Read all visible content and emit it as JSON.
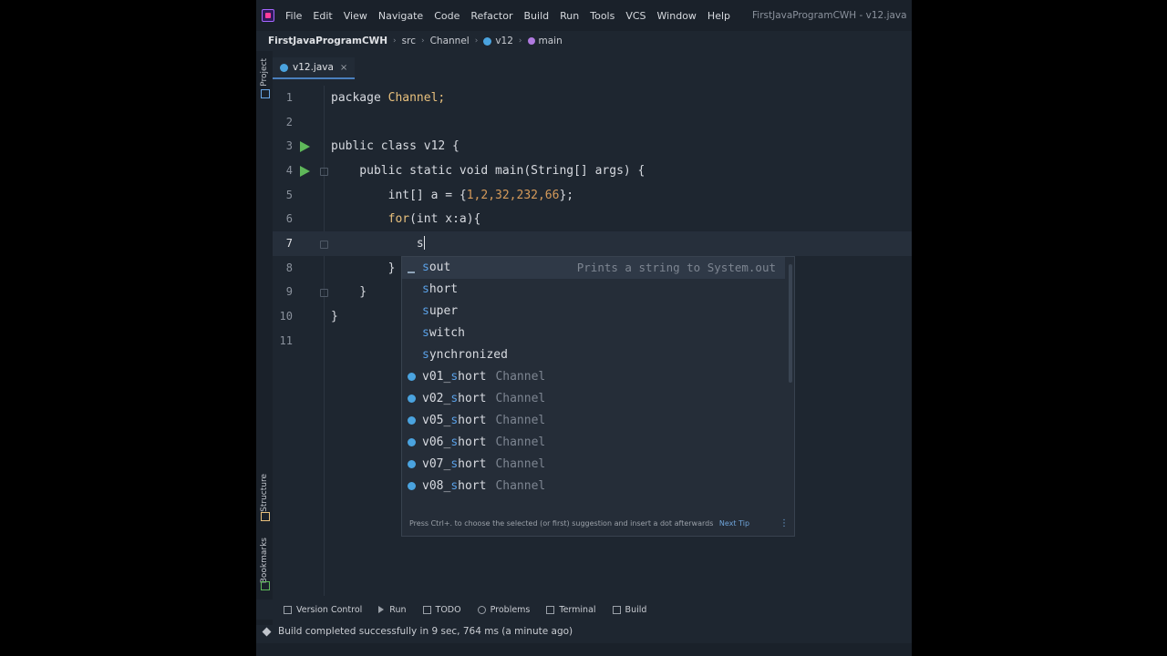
{
  "menubar": {
    "items": [
      "File",
      "Edit",
      "View",
      "Navigate",
      "Code",
      "Refactor",
      "Build",
      "Run",
      "Tools",
      "VCS",
      "Window",
      "Help"
    ],
    "window_title": "FirstJavaProgramCWH - v12.java"
  },
  "breadcrumb": [
    "FirstJavaProgramCWH",
    "src",
    "Channel",
    "v12",
    "main"
  ],
  "leftbar": {
    "project": "Project",
    "structure": "Structure",
    "bookmarks": "Bookmarks"
  },
  "tab": {
    "label": "v12.java",
    "close": "×"
  },
  "editor": {
    "lines": [
      {
        "n": "1"
      },
      {
        "n": "2"
      },
      {
        "n": "3"
      },
      {
        "n": "4"
      },
      {
        "n": "5"
      },
      {
        "n": "6"
      },
      {
        "n": "7"
      },
      {
        "n": "8"
      },
      {
        "n": "9"
      },
      {
        "n": "10"
      },
      {
        "n": "11"
      }
    ],
    "code": {
      "l1a": "package ",
      "l1b": "Channel;",
      "l3": "public class v12 {",
      "l4": "    public static void main(String[] args) {",
      "l5a": "        int[] a = {",
      "l5b": "1,2,32,232,66",
      "l5c": "};",
      "l6a": "        ",
      "l6b": "for",
      "l6c": "(int x:a){",
      "l7": "            s",
      "l8": "        }",
      "l9": "    }",
      "l10": "}"
    }
  },
  "completion": {
    "items": [
      {
        "prefix": "s",
        "rest": "out",
        "desc": "Prints a string to System.out",
        "pkg": ""
      },
      {
        "prefix": "s",
        "rest": "hort",
        "desc": "",
        "pkg": ""
      },
      {
        "prefix": "s",
        "rest": "uper",
        "desc": "",
        "pkg": ""
      },
      {
        "prefix": "s",
        "rest": "witch",
        "desc": "",
        "pkg": ""
      },
      {
        "prefix": "s",
        "rest": "ynchronized",
        "desc": "",
        "pkg": ""
      },
      {
        "before": "v01_",
        "prefix": "s",
        "rest": "hort",
        "pkg": "Channel"
      },
      {
        "before": "v02_",
        "prefix": "s",
        "rest": "hort",
        "pkg": "Channel"
      },
      {
        "before": "v05_",
        "prefix": "s",
        "rest": "hort",
        "pkg": "Channel"
      },
      {
        "before": "v06_",
        "prefix": "s",
        "rest": "hort",
        "pkg": "Channel"
      },
      {
        "before": "v07_",
        "prefix": "s",
        "rest": "hort",
        "pkg": "Channel"
      },
      {
        "before": "v08_",
        "prefix": "s",
        "rest": "hort",
        "pkg": "Channel"
      }
    ],
    "footer_text": "Press Ctrl+. to choose the selected (or first) suggestion and insert a dot afterwards",
    "footer_link": "Next Tip",
    "footer_menu": "⋮"
  },
  "toolwindows": [
    "Version Control",
    "Run",
    "TODO",
    "Problems",
    "Terminal",
    "Build"
  ],
  "status": {
    "message": "Build completed successfully in 9 sec, 764 ms (a minute ago)"
  },
  "colors": {
    "keyword": "#d7dae0",
    "number": "#d59a5a",
    "accent": "#4a7fbd",
    "run": "#5fb85a"
  }
}
